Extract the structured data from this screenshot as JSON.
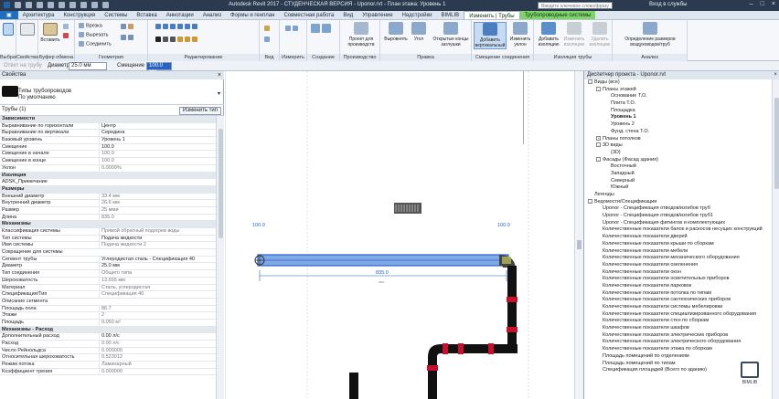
{
  "titlebar": {
    "title": "Autodesk Revit 2017 - СТУДЕНЧЕСКАЯ ВЕРСИЯ -   Uponor.rvt - План этажа: Уровень 1",
    "search_placeholder": "Введите ключевое слово/фразу",
    "user": "Вход в службы"
  },
  "tabs": [
    "Архитектура",
    "Конструкция",
    "Системы",
    "Вставка",
    "Аннотации",
    "Анализ",
    "Формы и генплан",
    "Совместная работа",
    "Вид",
    "Управление",
    "Надстройки",
    "BIMLIB",
    "Изменить | Трубы",
    "Трубопроводные системы"
  ],
  "ribbon": {
    "groups": [
      "Выбрать",
      "Свойства",
      "Буфер обмена",
      "Геометрия",
      "Редактирование",
      "Вид",
      "Измерить",
      "Создание",
      "Производство",
      "Правка",
      "Смещение соединения",
      "Изоляция трубы",
      "Анализ"
    ],
    "modify_label": "Изменить",
    "properties_label": "Свойства",
    "paste_label": "Вставить",
    "geometry_items": [
      "Врезка",
      "Вырезать",
      "Соединить"
    ],
    "create_parts": "Проект для производств",
    "add_outline": "Выровнять",
    "add_cap": "Угол",
    "open_ends": "Открытые концы заглушки",
    "add_vertical": "Добавить вертикальный",
    "change_angle": "Изменить уклон",
    "add_insulation": "Добавить изоляцию",
    "edit_insulation": "Изменить изоляцию",
    "remove_insulation": "Удалить изоляцию",
    "sizing": "Определение размеров воздуховодов/труб"
  },
  "options": {
    "reference": "Ответ на трубу",
    "diameter_label": "Диаметр",
    "diameter_value": "25.0 мм",
    "offset_label": "Смещение",
    "offset_value": "100.0 мм"
  },
  "properties": {
    "panel_title": "Свойства",
    "type_name": "Типы трубопроводов",
    "type_sub": "По умолчанию",
    "filter_label": "Трубы (1)",
    "edit_type": "Изменить тип",
    "rows": [
      {
        "k": "Зависимости",
        "v": "",
        "group": true
      },
      {
        "k": "Выравнивание по горизонтали",
        "v": "Центр"
      },
      {
        "k": "Выравнивание по вертикали",
        "v": "Середина"
      },
      {
        "k": "Базовый уровень",
        "v": "Уровень 1"
      },
      {
        "k": "Смещение",
        "v": "100.0"
      },
      {
        "k": "Смещение в начале",
        "v": "100.0",
        "dim": true
      },
      {
        "k": "Смещение в конце",
        "v": "100.0",
        "dim": true
      },
      {
        "k": "Уклон",
        "v": "0.0000%",
        "dim": true
      },
      {
        "k": "Изоляция",
        "v": "",
        "group": true
      },
      {
        "k": "ADSK_Примечание",
        "v": ""
      },
      {
        "k": "Размеры",
        "v": "",
        "group": true
      },
      {
        "k": "Внешний диаметр",
        "v": "33.4 мм",
        "dim": true
      },
      {
        "k": "Внутренний диаметр",
        "v": "26.6 мм",
        "dim": true
      },
      {
        "k": "Размер",
        "v": "25 ммø",
        "dim": true
      },
      {
        "k": "Длина",
        "v": "835.0",
        "dim": true
      },
      {
        "k": "Механизмы",
        "v": "",
        "group": true
      },
      {
        "k": "Классификация системы",
        "v": "Прямой обратный подогрев воды",
        "dim": true
      },
      {
        "k": "Тип системы",
        "v": "Подача жидкости"
      },
      {
        "k": "Имя системы",
        "v": "Подача жидкости 2",
        "dim": true
      },
      {
        "k": "Сокращение для системы",
        "v": "",
        "dim": true
      },
      {
        "k": "Сегмент трубы",
        "v": "Углеродистая сталь - Спецификация 40"
      },
      {
        "k": "Диаметр",
        "v": "25.0 мм"
      },
      {
        "k": "Тип соединения",
        "v": "Общего типа",
        "dim": true
      },
      {
        "k": "Шероховатость",
        "v": "13.655 мм",
        "dim": true
      },
      {
        "k": "Материал",
        "v": "Сталь, углеродистая",
        "dim": true
      },
      {
        "k": "Спецификация/Тип",
        "v": "Спецификация 40",
        "dim": true
      },
      {
        "k": "Описание сегмента",
        "v": "",
        "dim": true
      },
      {
        "k": "Площадь пола",
        "v": "86.7",
        "dim": true
      },
      {
        "k": "Этажи",
        "v": "2",
        "dim": true
      },
      {
        "k": "Площадь",
        "v": "0.050 м²",
        "dim": true
      },
      {
        "k": "Механизмы - Расход",
        "v": "",
        "group": true
      },
      {
        "k": "Дополнительный расход",
        "v": "0.00 л/с"
      },
      {
        "k": "Расход",
        "v": "0.00 л/с",
        "dim": true
      },
      {
        "k": "Число Рейнольдса",
        "v": "0.000000",
        "dim": true
      },
      {
        "k": "Относительная шероховатость",
        "v": "0.523012",
        "dim": true
      },
      {
        "k": "Режим потока",
        "v": "Ламинарный",
        "dim": true
      },
      {
        "k": "Коэффициент трения",
        "v": "0.000000",
        "dim": true
      }
    ]
  },
  "canvas": {
    "dim_left": "100.0",
    "dim_right": "100.0",
    "dim_length": "835.0"
  },
  "browser": {
    "title": "Диспетчер проекта - Uponor.rvt",
    "items": [
      {
        "t": "Виды (все)",
        "lvl": 0,
        "exp": "-"
      },
      {
        "t": "Планы этажей",
        "lvl": 1,
        "exp": "-"
      },
      {
        "t": "Основание Т.О.",
        "lvl": 2
      },
      {
        "t": "Плита Т.О.",
        "lvl": 2
      },
      {
        "t": "Площадка",
        "lvl": 2
      },
      {
        "t": "Уровень 1",
        "lvl": 2,
        "bold": true
      },
      {
        "t": "Уровень 2",
        "lvl": 2
      },
      {
        "t": "Фунд. стена Т.О.",
        "lvl": 2
      },
      {
        "t": "Планы потолков",
        "lvl": 1,
        "exp": "+"
      },
      {
        "t": "3D виды",
        "lvl": 1,
        "exp": "-"
      },
      {
        "t": "{3D}",
        "lvl": 2
      },
      {
        "t": "Фасады (Фасад здания)",
        "lvl": 1,
        "exp": "-"
      },
      {
        "t": "Восточный",
        "lvl": 2
      },
      {
        "t": "Западный",
        "lvl": 2
      },
      {
        "t": "Северный",
        "lvl": 2
      },
      {
        "t": "Южный",
        "lvl": 2
      },
      {
        "t": "Легенды",
        "lvl": 0
      },
      {
        "t": "Ведомости/Спецификации",
        "lvl": 0,
        "exp": "-"
      },
      {
        "t": "Uponor - Спецификация отводов/изгибов труб",
        "lvl": 1
      },
      {
        "t": "Uponor - Спецификация отводов/изгибов труб1",
        "lvl": 1
      },
      {
        "t": "Uponor - Спецификация фитингов и комплектующих",
        "lvl": 1
      },
      {
        "t": "Количественные показатели балок и раскосов несущих конструкций",
        "lvl": 1
      },
      {
        "t": "Количественные показатели дверей",
        "lvl": 1
      },
      {
        "t": "Количественные показатели крыши по сборкам",
        "lvl": 1
      },
      {
        "t": "Количественные показатели мебели",
        "lvl": 1
      },
      {
        "t": "Количественные показатели механического оборудования",
        "lvl": 1
      },
      {
        "t": "Количественные показатели озеленения",
        "lvl": 1
      },
      {
        "t": "Количественные показатели окон",
        "lvl": 1
      },
      {
        "t": "Количественные показатели осветительных приборов",
        "lvl": 1
      },
      {
        "t": "Количественные показатели парковок",
        "lvl": 1
      },
      {
        "t": "Количественные показатели потолка по типам",
        "lvl": 1
      },
      {
        "t": "Количественные показатели сантехнических приборов",
        "lvl": 1
      },
      {
        "t": "Количественные показатели системы мебелировки",
        "lvl": 1
      },
      {
        "t": "Количественные показатели специализированного оборудования",
        "lvl": 1
      },
      {
        "t": "Количественные показатели стен по сборкам",
        "lvl": 1
      },
      {
        "t": "Количественные показатели шкафов",
        "lvl": 1
      },
      {
        "t": "Количественные показатели электрических приборов",
        "lvl": 1
      },
      {
        "t": "Количественные показатели электрического оборудования",
        "lvl": 1
      },
      {
        "t": "Количественные показатели этажа по сборкам",
        "lvl": 1
      },
      {
        "t": "Площадь помещений по отделениям",
        "lvl": 1
      },
      {
        "t": "Площадь помещений по типам",
        "lvl": 1
      },
      {
        "t": "Спецификация площадей (Всего по зданию)",
        "lvl": 1
      }
    ]
  },
  "logo": {
    "text": "BIMLIB"
  }
}
